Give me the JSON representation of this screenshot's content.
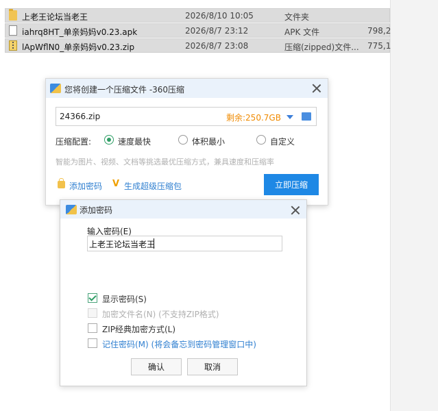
{
  "explorer": {
    "files": [
      {
        "name": "上老王论坛当老王",
        "date": "2026/8/10 10:05",
        "type": "文件夹",
        "size": "",
        "icon": "folder-icon"
      },
      {
        "name": "iahrq8HT_单亲妈妈v0.23.apk",
        "date": "2026/8/7 23:12",
        "type": "APK 文件",
        "size": "798,2",
        "icon": "document-icon"
      },
      {
        "name": "lApWflN0_单亲妈妈v0.23.zip",
        "date": "2026/8/7 23:08",
        "type": "压缩(zipped)文件...",
        "size": "775,1",
        "icon": "zip-icon"
      }
    ]
  },
  "compress_dialog": {
    "title": "您将创建一个压缩文件 -360压缩",
    "filename": "24366.zip",
    "free_space": "剩余:250.7GB",
    "config_label": "压缩配置:",
    "options": [
      {
        "label": "速度最快",
        "selected": true
      },
      {
        "label": "体积最小",
        "selected": false
      },
      {
        "label": "自定义",
        "selected": false
      }
    ],
    "hint": "智能为图片、视频、文档等挑选最优压缩方式，兼具速度和压缩率",
    "add_password": "添加密码",
    "super_pack": "生成超级压缩包",
    "compress_button": "立即压缩"
  },
  "password_dialog": {
    "title": "添加密码",
    "input_label": "输入密码(E)",
    "password_value": "上老王论坛当老王",
    "checkboxes": [
      {
        "label": "显示密码(S)",
        "checked": true,
        "enabled": true
      },
      {
        "label": "加密文件名(N) (不支持ZIP格式)",
        "checked": false,
        "enabled": false
      },
      {
        "label": "ZIP经典加密方式(L)",
        "checked": false,
        "enabled": true
      },
      {
        "label": "记住密码(M) (将会备忘到密码管理窗口中)",
        "checked": false,
        "enabled": true
      }
    ],
    "ok_button": "确认",
    "cancel_button": "取消"
  },
  "colors": {
    "accent": "#1e88e5",
    "link": "#2f7fd0",
    "free_space": "#f08a00",
    "radio_selected": "#2f9e66",
    "titlebar": "#eaf2fb"
  }
}
